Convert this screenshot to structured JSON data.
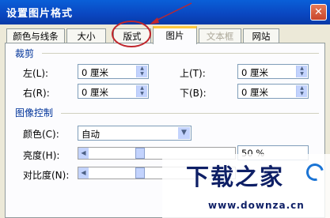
{
  "window": {
    "title": "设置图片格式",
    "close_glyph": "✕"
  },
  "tabs": [
    {
      "label": "颜色与线条"
    },
    {
      "label": "大小"
    },
    {
      "label": "版式"
    },
    {
      "label": "图片"
    },
    {
      "label": "文本框"
    },
    {
      "label": "网站"
    }
  ],
  "crop": {
    "group_label": "裁剪",
    "left_label": "左(L):",
    "left_value": "0 厘米",
    "top_label": "上(T):",
    "top_value": "0 厘米",
    "right_label": "右(R):",
    "right_value": "0 厘米",
    "bottom_label": "下(B):",
    "bottom_value": "0 厘米"
  },
  "image_control": {
    "group_label": "图像控制",
    "color_label": "颜色(C):",
    "color_value": "自动",
    "brightness_label": "亮度(H):",
    "brightness_value_partial": "50 %",
    "contrast_label": "对比度(N):"
  },
  "watermark": {
    "main": "下载之家",
    "url": "www.downza.cn"
  },
  "colors": {
    "titlebar": "#0a46c0",
    "annotation": "#c0262c",
    "active_tab_highlight": "#ffc83c"
  }
}
